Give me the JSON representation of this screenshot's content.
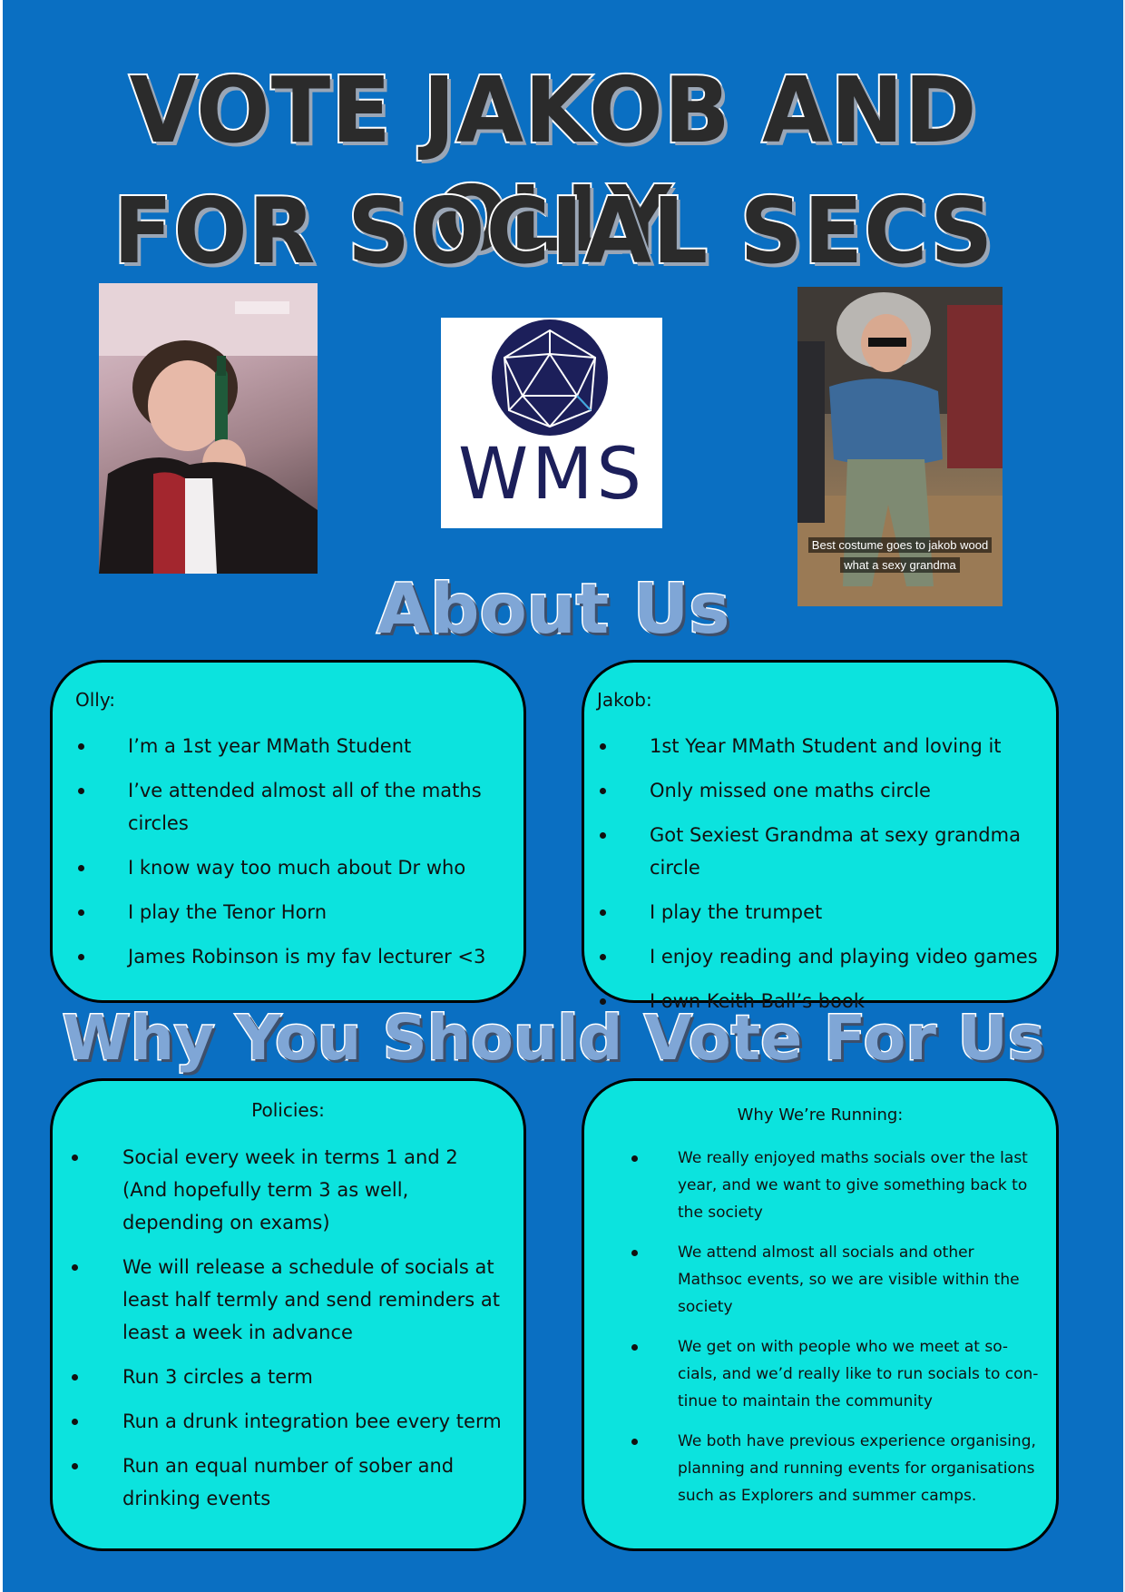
{
  "headline": {
    "line1": "VOTE JAKOB AND OLLY",
    "line2": "FOR SOCIAL SECS"
  },
  "logo": {
    "text": "WMS"
  },
  "jakob_photo": {
    "caption_line1": "Best costume goes to  jakob wood",
    "caption_line2": "what a sexy grandma"
  },
  "about": {
    "title": "About Us",
    "olly": {
      "heading": "Olly:",
      "items": [
        "I’m a 1st year MMath Student",
        "I’ve attended almost all of the maths circles",
        "I know way too much about Dr who",
        "I play the Tenor Horn",
        "James Robinson is my fav lecturer <3"
      ]
    },
    "jakob": {
      "heading": "Jakob:",
      "items": [
        "1st Year MMath Student and loving it",
        "Only missed one maths circle",
        "Got Sexiest Grandma at sexy grandma circle",
        "I play the trumpet",
        "I enjoy reading and playing video games",
        "I own Keith Ball’s book"
      ]
    }
  },
  "why": {
    "title": "Why You Should Vote For Us",
    "policies": {
      "heading": "Policies:",
      "items": [
        "Social every week in terms 1 and 2 (And hopefully term 3 as well, depending on exams)",
        "We will release  a schedule of socials at least half termly and send reminders at least a week in advance",
        "Run 3 circles a term",
        "Run a drunk integration bee every term",
        "Run an equal number of sober and drinking events"
      ]
    },
    "running": {
      "heading": "Why We’re Running:",
      "items": [
        "We really enjoyed maths socials over the last year, and we want to give something back to the society",
        "We attend almost all socials and other Mathsoc events, so we are visible within the society",
        "We get on with people who we meet at so-cials, and we’d really like to run socials to con-tinue to maintain the community",
        "We both have previous experience organising, planning and running events for organisations such as Explorers and summer camps."
      ]
    }
  }
}
